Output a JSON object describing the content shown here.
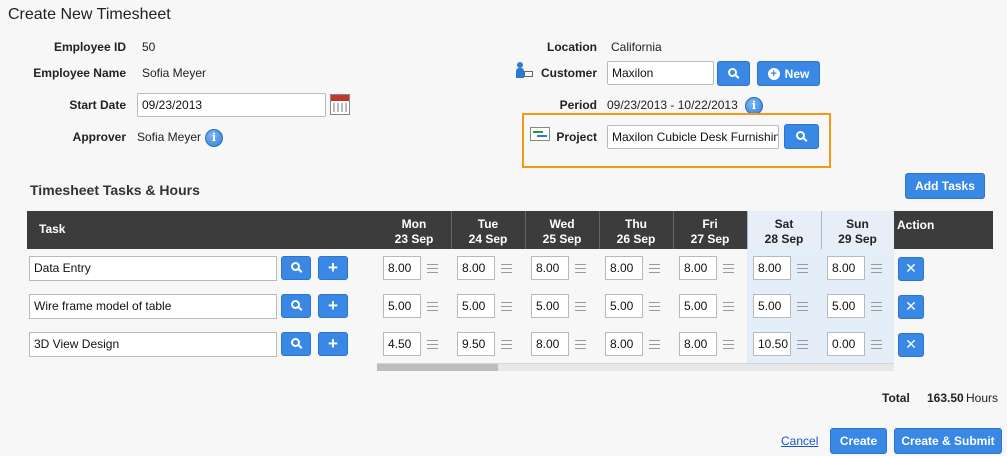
{
  "page": {
    "title": "Create New Timesheet"
  },
  "info": {
    "employee_id_label": "Employee ID",
    "employee_id": "50",
    "employee_name_label": "Employee Name",
    "employee_name": "Sofia Meyer",
    "start_date_label": "Start Date",
    "start_date": "09/23/2013",
    "approver_label": "Approver",
    "approver": "Sofia Meyer",
    "location_label": "Location",
    "location": "California",
    "customer_label": "Customer",
    "customer": "Maxilon",
    "new_label": "New",
    "period_label": "Period",
    "period": "09/23/2013 - 10/22/2013",
    "project_label": "Project",
    "project": "Maxilon Cubicle Desk Furnishin",
    "info_glyph": "i"
  },
  "section": {
    "title": "Timesheet Tasks & Hours",
    "add_tasks": "Add Tasks"
  },
  "table": {
    "task_header": "Task",
    "action_header": "Action",
    "days": [
      {
        "dow": "Mon",
        "date": "23 Sep"
      },
      {
        "dow": "Tue",
        "date": "24 Sep"
      },
      {
        "dow": "Wed",
        "date": "25 Sep"
      },
      {
        "dow": "Thu",
        "date": "26 Sep"
      },
      {
        "dow": "Fri",
        "date": "27 Sep"
      },
      {
        "dow": "Sat",
        "date": "28 Sep"
      },
      {
        "dow": "Sun",
        "date": "29 Sep"
      }
    ],
    "rows": [
      {
        "task": "Data Entry",
        "hours": [
          "8.00",
          "8.00",
          "8.00",
          "8.00",
          "8.00",
          "8.00",
          "8.00"
        ]
      },
      {
        "task": "Wire frame model of table",
        "hours": [
          "5.00",
          "5.00",
          "5.00",
          "5.00",
          "5.00",
          "5.00",
          "5.00"
        ]
      },
      {
        "task": "3D View Design",
        "hours": [
          "4.50",
          "9.50",
          "8.00",
          "8.00",
          "8.00",
          "10.50",
          "0.00"
        ]
      }
    ],
    "add_glyph": "+",
    "delete_glyph": "✕"
  },
  "totals": {
    "label": "Total",
    "value": "163.50",
    "unit": "Hours"
  },
  "footer": {
    "cancel": "Cancel",
    "create": "Create",
    "create_submit": "Create & Submit"
  },
  "colors": {
    "accent": "#3a88e6",
    "highlight": "#f39a12",
    "header": "#3c3c3c",
    "weekend": "#e4eef8"
  }
}
